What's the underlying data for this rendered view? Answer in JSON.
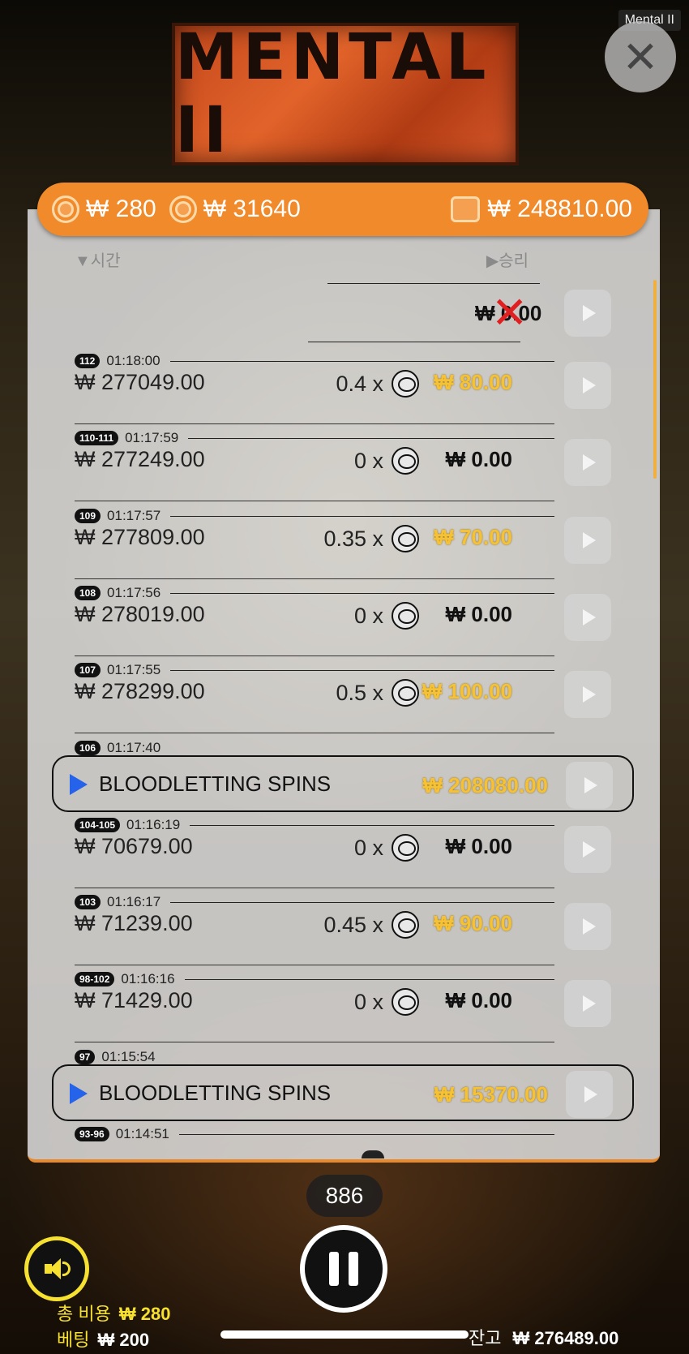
{
  "app": {
    "title_tag": "Mental II",
    "logo_text": "MENTAL II"
  },
  "topbar": {
    "total_bet": "₩ 280",
    "spin_total": "₩ 31640",
    "balance": "₩ 248810.00"
  },
  "columns": {
    "time": "▼시간",
    "win": "▶승리"
  },
  "first_row": {
    "win": "₩ 0.00"
  },
  "history": [
    {
      "id": "112",
      "time": "01:18:00",
      "balance": "₩ 277049.00",
      "multiplier": "0.4 x",
      "win": "₩ 80.00",
      "gold": true
    },
    {
      "id": "110-111",
      "time": "01:17:59",
      "balance": "₩ 277249.00",
      "multiplier": "0 x",
      "win": "₩ 0.00",
      "gold": false
    },
    {
      "id": "109",
      "time": "01:17:57",
      "balance": "₩ 277809.00",
      "multiplier": "0.35 x",
      "win": "₩ 70.00",
      "gold": true
    },
    {
      "id": "108",
      "time": "01:17:56",
      "balance": "₩ 278019.00",
      "multiplier": "0 x",
      "win": "₩ 0.00",
      "gold": false
    },
    {
      "id": "107",
      "time": "01:17:55",
      "balance": "₩ 278299.00",
      "multiplier": "0.5 x",
      "win": "₩ 100.00",
      "gold": true
    },
    {
      "id": "106",
      "time": "01:17:40",
      "bonus": "BLOODLETTING SPINS",
      "win": "₩ 208080.00"
    },
    {
      "id": "104-105",
      "time": "01:16:19",
      "balance": "₩ 70679.00",
      "multiplier": "0 x",
      "win": "₩ 0.00",
      "gold": false
    },
    {
      "id": "103",
      "time": "01:16:17",
      "balance": "₩ 71239.00",
      "multiplier": "0.45 x",
      "win": "₩ 90.00",
      "gold": true
    },
    {
      "id": "98-102",
      "time": "01:16:16",
      "balance": "₩ 71429.00",
      "multiplier": "0 x",
      "win": "₩ 0.00",
      "gold": false
    },
    {
      "id": "97",
      "time": "01:15:54",
      "bonus": "BLOODLETTING SPINS",
      "win": "₩ 15370.00"
    },
    {
      "id": "93-96",
      "time": "01:14:51"
    }
  ],
  "controls": {
    "counter": "886"
  },
  "footer": {
    "total_cost_label": "총 비용",
    "total_cost_value": "₩ 280",
    "bet_label": "베팅",
    "bet_value": "₩ 200",
    "balance_label": "잔고",
    "balance_value": "₩ 276489.00"
  },
  "colors": {
    "accent": "#f08a2a",
    "gold": "#f6c234",
    "bonus_arrow": "#2563eb",
    "sound": "#f6e030"
  }
}
